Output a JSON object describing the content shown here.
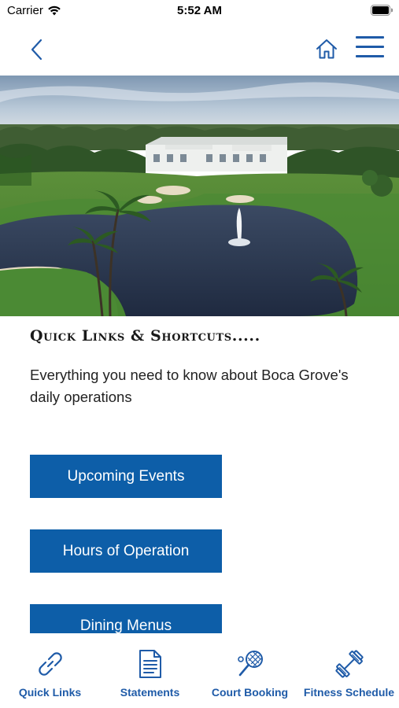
{
  "status_bar": {
    "carrier": "Carrier",
    "time": "5:52 AM"
  },
  "nav": {
    "back_icon": "chevron-left-icon",
    "home_icon": "home-icon",
    "menu_icon": "hamburger-menu-icon"
  },
  "hero_image": {
    "subject": "golf-course-clubhouse-aerial"
  },
  "section": {
    "title": "Quick Links & Shortcuts.....",
    "description": "Everything you need to know about Boca Grove's daily operations"
  },
  "buttons": [
    {
      "label": "Upcoming Events"
    },
    {
      "label": "Hours of Operation"
    },
    {
      "label": "Dining Menus"
    }
  ],
  "tab_bar": {
    "items": [
      {
        "label": "Quick Links",
        "icon": "link-icon"
      },
      {
        "label": "Statements",
        "icon": "document-icon"
      },
      {
        "label": "Court Booking",
        "icon": "tennis-racket-icon"
      },
      {
        "label": "Fitness Schedule",
        "icon": "dumbbell-icon"
      }
    ]
  },
  "colors": {
    "accent": "#1f5ba8",
    "button_bg": "#0d5ea8",
    "button_text": "#ffffff"
  }
}
